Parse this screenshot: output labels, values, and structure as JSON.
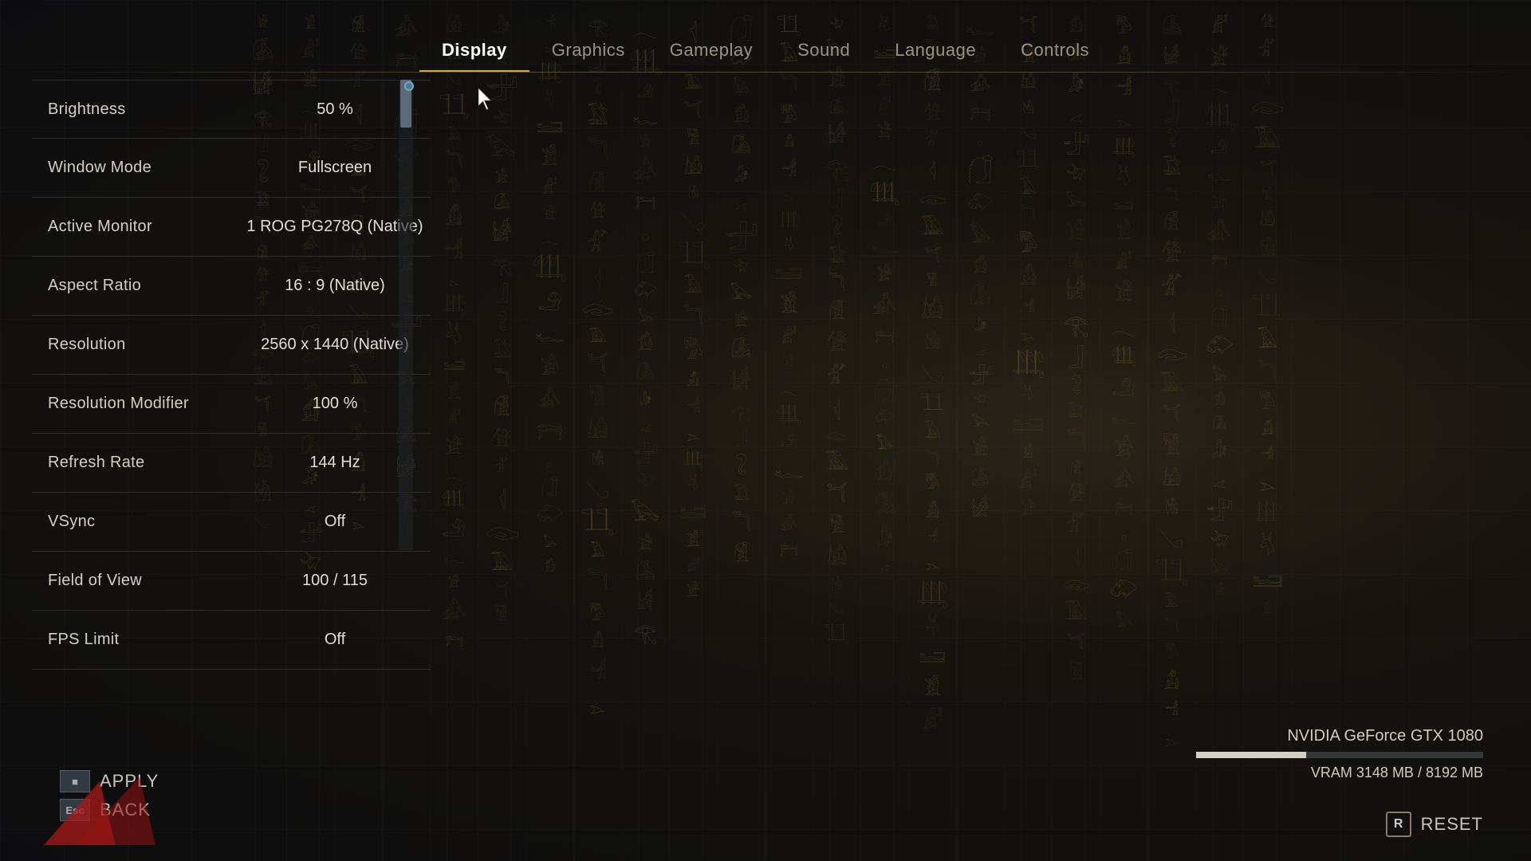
{
  "nav": {
    "tabs": [
      {
        "id": "display",
        "label": "Display",
        "active": true
      },
      {
        "id": "graphics",
        "label": "Graphics",
        "active": false
      },
      {
        "id": "gameplay",
        "label": "Gameplay",
        "active": false
      },
      {
        "id": "sound",
        "label": "Sound",
        "active": false
      },
      {
        "id": "language",
        "label": "Language",
        "active": false
      },
      {
        "id": "controls",
        "label": "Controls",
        "active": false
      }
    ]
  },
  "settings": {
    "rows": [
      {
        "id": "brightness",
        "label": "Brightness",
        "value": "50 %"
      },
      {
        "id": "window-mode",
        "label": "Window Mode",
        "value": "Fullscreen"
      },
      {
        "id": "active-monitor",
        "label": "Active Monitor",
        "value": "1 ROG PG278Q (Native)"
      },
      {
        "id": "aspect-ratio",
        "label": "Aspect Ratio",
        "value": "16 : 9 (Native)"
      },
      {
        "id": "resolution",
        "label": "Resolution",
        "value": "2560 x 1440 (Native)"
      },
      {
        "id": "resolution-modifier",
        "label": "Resolution Modifier",
        "value": "100 %"
      },
      {
        "id": "refresh-rate",
        "label": "Refresh Rate",
        "value": "144 Hz"
      },
      {
        "id": "vsync",
        "label": "VSync",
        "value": "Off"
      },
      {
        "id": "field-of-view",
        "label": "Field of View",
        "value": "100 / 115"
      },
      {
        "id": "fps-limit",
        "label": "FPS Limit",
        "value": "Off"
      }
    ]
  },
  "gpu": {
    "name": "NVIDIA GeForce GTX 1080",
    "vram_used": "3148",
    "vram_total": "8192",
    "vram_label": "VRAM 3148 MB / 8192 MB",
    "vram_percent": 38.4
  },
  "buttons": {
    "apply_label": "APPLY",
    "apply_key": "■",
    "back_label": "BACK",
    "back_key": "Esc",
    "reset_label": "RESET",
    "reset_key": "R"
  },
  "hieroglyphs": {
    "symbols": [
      "𓀀",
      "𓀁",
      "𓀂",
      "𓀃",
      "𓀄",
      "𓀅",
      "𓀆",
      "𓀇",
      "𓀈",
      "𓀉",
      "𓀊",
      "𓀋",
      "𓀌",
      "𓀍",
      "𓀎",
      "𓀏",
      "𓁀",
      "𓁁",
      "𓁂",
      "𓁃",
      "𓁄",
      "𓂀",
      "𓂁",
      "𓂂",
      "𓂃",
      "𓂄",
      "𓂅",
      "𓂆",
      "𓃀",
      "𓃁",
      "𓃂",
      "𓃃",
      "𓃄",
      "𓃅",
      "𓃆",
      "𓃇",
      "𓄀",
      "𓄁",
      "𓄂",
      "𓄃",
      "𓄿",
      "𓅀",
      "𓅁",
      "𓅂",
      "𓅃",
      "𓆑",
      "𓆒",
      "𓆓",
      "𓆔",
      "𓆕"
    ]
  }
}
